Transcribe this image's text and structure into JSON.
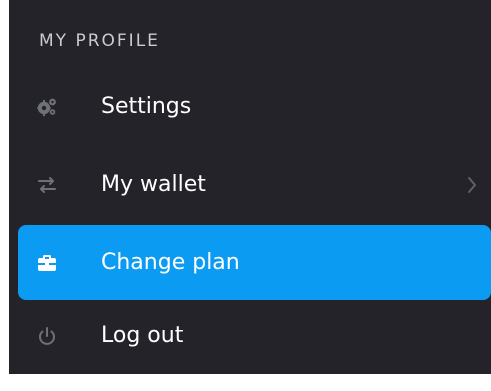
{
  "profile_menu": {
    "section_title": "MY PROFILE",
    "items": [
      {
        "label": "Settings",
        "icon": "gears-icon",
        "active": false
      },
      {
        "label": "My wallet",
        "icon": "transfer-arrows-icon",
        "active": false,
        "has_submenu": true
      },
      {
        "label": "Change plan",
        "icon": "briefcase-icon",
        "active": true
      },
      {
        "label": "Log out",
        "icon": "power-icon",
        "active": false
      }
    ]
  },
  "colors": {
    "background": "#232329",
    "active_item": "#0b9bf2",
    "text": "#ffffff",
    "section_title": "#c9cbd1",
    "icon_muted": "#6f7178"
  }
}
